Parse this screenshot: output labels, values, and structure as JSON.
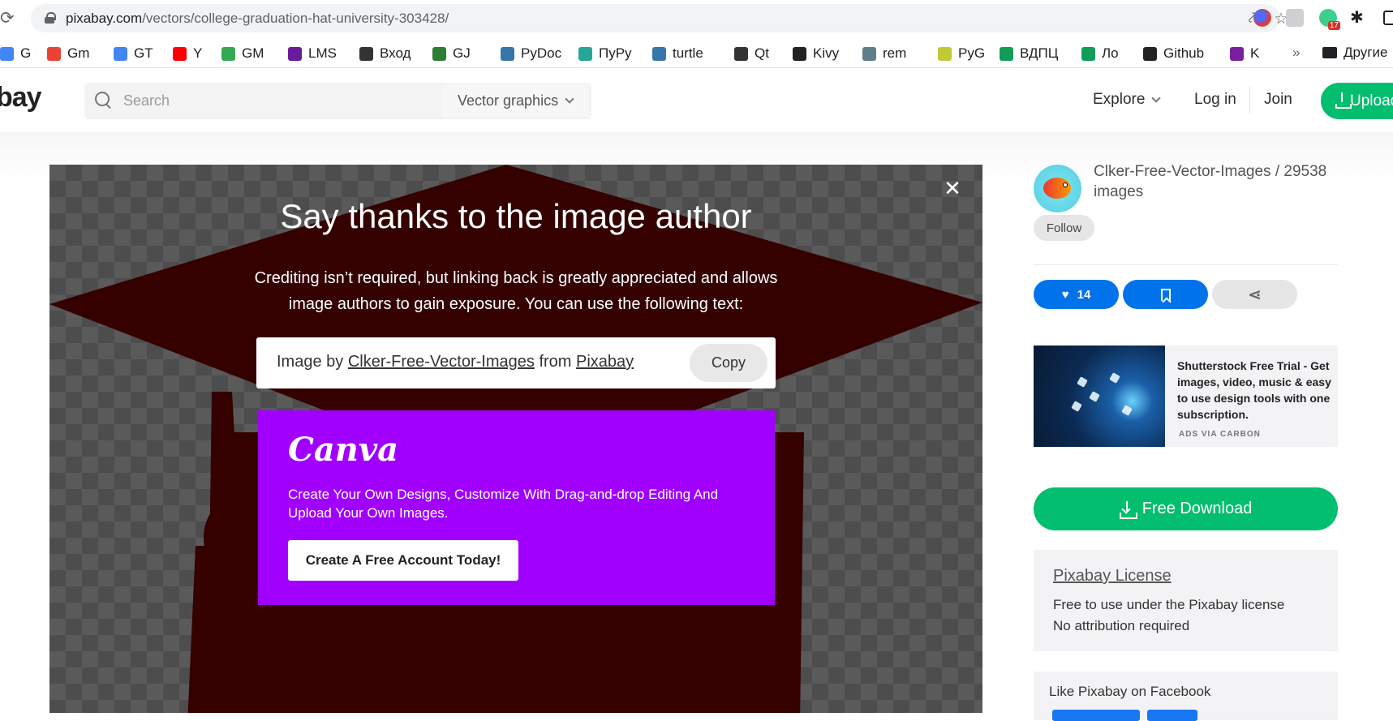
{
  "browser": {
    "url_host": "pixabay.com",
    "url_path": "/vectors/college-graduation-hat-university-303428/",
    "extension_badge": "17",
    "bookmarks": [
      {
        "label": "G",
        "color": "#4285f4"
      },
      {
        "label": "Gm",
        "color": "#ea4335"
      },
      {
        "label": "GT",
        "color": "#4285f4"
      },
      {
        "label": "Y",
        "color": "#ff0000"
      },
      {
        "label": "GM",
        "color": "#34a853"
      },
      {
        "label": "LMS",
        "color": "#6a1b9a"
      },
      {
        "label": "Вход",
        "color": "#333333"
      },
      {
        "label": "GJ",
        "color": "#2e7d32"
      },
      {
        "label": "PyDoc",
        "color": "#3776ab"
      },
      {
        "label": "ПуРу",
        "color": "#26a69a"
      },
      {
        "label": "turtle",
        "color": "#3776ab"
      },
      {
        "label": "Qt",
        "color": "#333333"
      },
      {
        "label": "Kivy",
        "color": "#222222"
      },
      {
        "label": "rem",
        "color": "#607d8b"
      },
      {
        "label": "PyG",
        "color": "#c0ca33"
      },
      {
        "label": "ВДПЦ",
        "color": "#0f9d58"
      },
      {
        "label": "Ло",
        "color": "#0f9d58"
      },
      {
        "label": "Github",
        "color": "#222222"
      },
      {
        "label": "K",
        "color": "#7b1fa2"
      }
    ],
    "more_label": "»",
    "folder_label": "Другие"
  },
  "header": {
    "logo": "bay",
    "search_placeholder": "Search",
    "type_select": "Vector graphics",
    "explore": "Explore",
    "login": "Log in",
    "join": "Join",
    "upload": "Upload"
  },
  "modal": {
    "close": "✕",
    "title": "Say thanks to the image author",
    "description": "Crediting isn’t required, but linking back is greatly appreciated and allows image authors to gain exposure. You can use the following text:",
    "credit_prefix": "Image by",
    "credit_author": "Clker-Free-Vector-Images",
    "credit_mid": "from",
    "credit_site": "Pixabay",
    "copy": "Copy"
  },
  "canva": {
    "logo": "Canva",
    "text": "Create Your Own Designs, Customize With Drag-and-drop Editing And Upload Your Own Images.",
    "button": "Create A Free Account Today!"
  },
  "sidebar": {
    "author": "Clker-Free-Vector-Images / 29538 images",
    "follow": "Follow",
    "likes": "14",
    "ad_text": "Shutterstock Free Trial - Get images, video, music & easy to use design tools with one subscription.",
    "ad_via": "ADS VIA CARBON",
    "download": "Free Download",
    "license_title": "Pixabay License",
    "license_line1": "Free to use under the Pixabay license",
    "license_line2": "No attribution required",
    "facebook": "Like Pixabay on Facebook"
  },
  "colors": {
    "brand_green": "#02be6e",
    "like_blue": "#0173ea",
    "canva_purple": "#a100ff",
    "hat_color": "#340000"
  }
}
